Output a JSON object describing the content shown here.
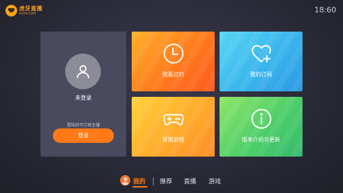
{
  "header": {
    "logo_text": "虎牙直播",
    "logo_sub": "HUYA.COM",
    "clock": "18:60"
  },
  "user_panel": {
    "name": "未登录",
    "hint": "登陆后可订阅主播",
    "login_label": "登录",
    "avatar_icon": "user-icon"
  },
  "tiles": [
    {
      "label": "我看过的",
      "icon": "clock-icon",
      "color": "#ff7a1c"
    },
    {
      "label": "我的订阅",
      "icon": "heart-plus-icon",
      "color": "#38b2ec"
    },
    {
      "label": "常用游戏",
      "icon": "gamepad-icon",
      "color": "#ffab2a"
    },
    {
      "label": "版本介绍与更新",
      "icon": "info-icon",
      "color": "#4fcf6a"
    }
  ],
  "bottom_nav": {
    "items": [
      "我的",
      "推荐",
      "直播",
      "游戏"
    ],
    "active_index": 0
  },
  "colors": {
    "accent": "#ff7a16",
    "background": "#2a2a38",
    "panel": "#4a4a5e"
  }
}
